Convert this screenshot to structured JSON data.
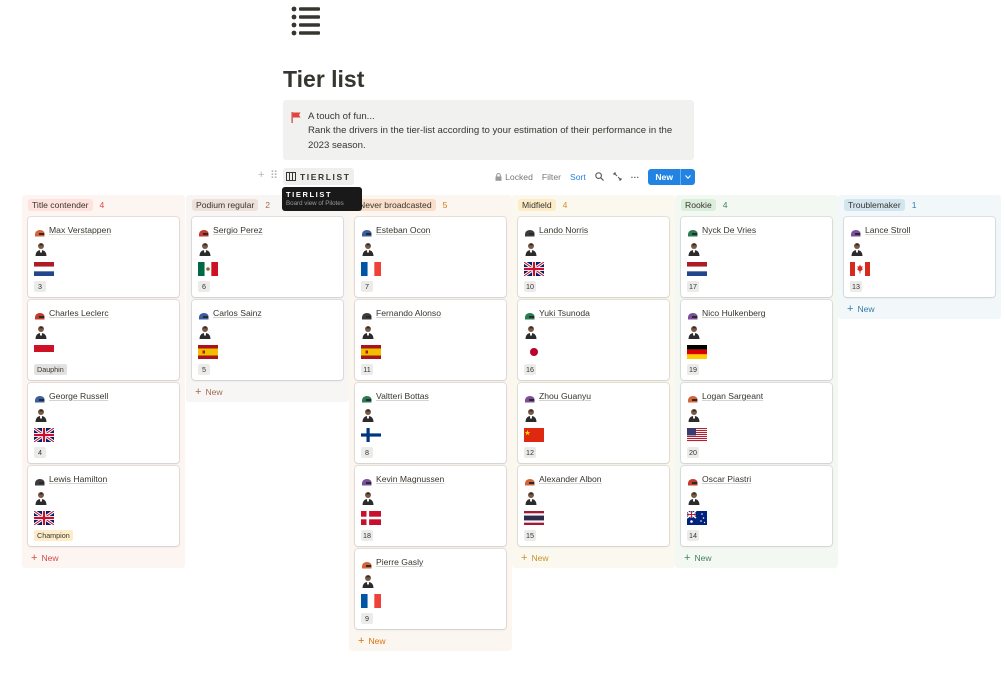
{
  "page": {
    "title": "Tier list",
    "icon": "bulleted-list-icon"
  },
  "callout": {
    "icon": "red-flag-icon",
    "lines": [
      "A touch of fun...",
      "Rank the drivers in the tier-list according to your estimation of their performance in the",
      "2023 season."
    ]
  },
  "toolbar": {
    "view_label": "TIERLIST",
    "view_icon": "board-view-icon",
    "locked_label": "Locked",
    "filter_label": "Filter",
    "sort_label": "Sort",
    "new_label": "New"
  },
  "tooltip": {
    "title": "TIERLIST",
    "subtitle": "Board view of Pilotes"
  },
  "columns": [
    {
      "name": "Title contender",
      "count": "4",
      "pill_color": "#ffe2dd",
      "count_color": "#d44c47",
      "bg": "#fdf5f2",
      "add_label": "New",
      "cards": [
        {
          "name": "Max Verstappen",
          "flag": "netherlands-flag",
          "number": "3",
          "badge": null
        },
        {
          "name": "Charles Leclerc",
          "flag": "monaco-flag",
          "number": null,
          "badge": "Dauphin"
        },
        {
          "name": "George Russell",
          "flag": "uk-flag",
          "number": "4",
          "badge": null
        },
        {
          "name": "Lewis Hamilton",
          "flag": "uk-flag",
          "number": null,
          "badge": "Champion"
        }
      ]
    },
    {
      "name": "Podium regular",
      "count": "2",
      "pill_color": "#eee0da",
      "count_color": "#9f6b53",
      "bg": "#f8f6f4",
      "add_label": "New",
      "cards": [
        {
          "name": "Sergio Perez",
          "flag": "mexico-flag",
          "number": "6",
          "badge": null
        },
        {
          "name": "Carlos Sainz",
          "flag": "spain-flag",
          "number": "5",
          "badge": null
        }
      ]
    },
    {
      "name": "Never broadcasted",
      "count": "5",
      "pill_color": "#fadec9",
      "count_color": "#d9730d",
      "bg": "#fcf6f1",
      "add_label": "New",
      "cards": [
        {
          "name": "Esteban Ocon",
          "flag": "france-flag",
          "number": "7",
          "badge": null
        },
        {
          "name": "Fernando Alonso",
          "flag": "spain-flag",
          "number": "11",
          "badge": null
        },
        {
          "name": "Valtteri Bottas",
          "flag": "finland-flag",
          "number": "8",
          "badge": null
        },
        {
          "name": "Kevin Magnussen",
          "flag": "denmark-flag",
          "number": "18",
          "badge": null
        },
        {
          "name": "Pierre Gasly",
          "flag": "france-flag",
          "number": "9",
          "badge": null
        }
      ]
    },
    {
      "name": "Midfield",
      "count": "4",
      "pill_color": "#fdecc8",
      "count_color": "#cb912f",
      "bg": "#fbf8ef",
      "add_label": "New",
      "cards": [
        {
          "name": "Lando Norris",
          "flag": "uk-flag",
          "number": "10",
          "badge": null
        },
        {
          "name": "Yuki Tsunoda",
          "flag": "japan-flag",
          "number": "16",
          "badge": null
        },
        {
          "name": "Zhou Guanyu",
          "flag": "china-flag",
          "number": "12",
          "badge": null
        },
        {
          "name": "Alexander Albon",
          "flag": "thailand-flag",
          "number": "15",
          "badge": null
        }
      ]
    },
    {
      "name": "Rookie",
      "count": "4",
      "pill_color": "#dbeddb",
      "count_color": "#448361",
      "bg": "#f4f8f3",
      "add_label": "New",
      "cards": [
        {
          "name": "Nyck De Vries",
          "flag": "netherlands-flag",
          "number": "17",
          "badge": null
        },
        {
          "name": "Nico Hulkenberg",
          "flag": "germany-flag",
          "number": "19",
          "badge": null
        },
        {
          "name": "Logan Sargeant",
          "flag": "usa-flag",
          "number": "20",
          "badge": null
        },
        {
          "name": "Oscar Piastri",
          "flag": "australia-flag",
          "number": "14",
          "badge": null
        }
      ]
    },
    {
      "name": "Troublemaker",
      "count": "1",
      "pill_color": "#d3e5ef",
      "count_color": "#337ea9",
      "bg": "#f2f7fa",
      "add_label": "New",
      "cards": [
        {
          "name": "Lance Stroll",
          "flag": "canada-flag",
          "number": "13",
          "badge": null
        }
      ]
    }
  ],
  "badge_colors": {
    "Dauphin": "#e3e2e0",
    "Champion": "#fdecc8"
  }
}
